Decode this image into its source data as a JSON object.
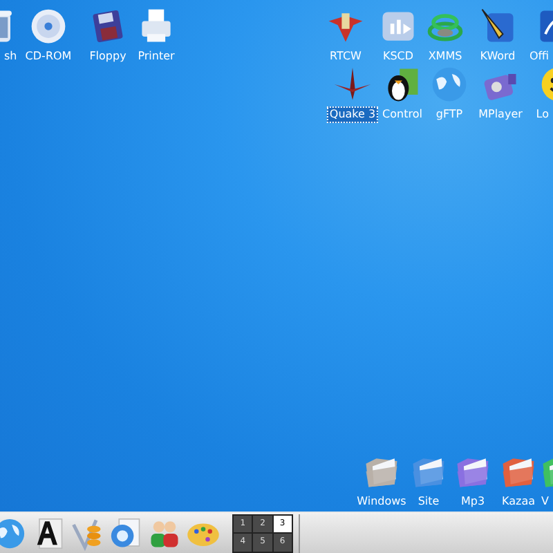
{
  "desktop_icons": [
    {
      "label": "sh",
      "kind": "trash",
      "selected": false
    },
    {
      "label": "CD-ROM",
      "kind": "cd",
      "selected": false
    },
    {
      "label": "Floppy",
      "kind": "floppy",
      "selected": false
    },
    {
      "label": "Printer",
      "kind": "printer",
      "selected": false
    },
    {
      "label": "RTCW",
      "kind": "emblem",
      "selected": false
    },
    {
      "label": "KSCD",
      "kind": "media",
      "selected": false
    },
    {
      "label": "XMMS",
      "kind": "rings",
      "selected": false
    },
    {
      "label": "KWord",
      "kind": "pen",
      "selected": false
    },
    {
      "label": "Offi",
      "kind": "document",
      "selected": false
    },
    {
      "label": "Quake 3",
      "kind": "jet",
      "selected": true
    },
    {
      "label": "Control",
      "kind": "penguin",
      "selected": false
    },
    {
      "label": "gFTP",
      "kind": "globe",
      "selected": false
    },
    {
      "label": "MPlayer",
      "kind": "camera",
      "selected": false
    },
    {
      "label": "Lo",
      "kind": "smiley",
      "selected": false
    },
    {
      "label": "Windows",
      "kind": "folder",
      "color": "#b8b0a8",
      "selected": false
    },
    {
      "label": "Site",
      "kind": "folder",
      "color": "#4a90e0",
      "selected": false
    },
    {
      "label": "Mp3",
      "kind": "folder",
      "color": "#8a70e0",
      "selected": false
    },
    {
      "label": "Kazaa",
      "kind": "folder",
      "color": "#e06040",
      "selected": false
    },
    {
      "label": "V",
      "kind": "folder",
      "color": "#40c060",
      "selected": false
    }
  ],
  "taskbar": {
    "launchers": [
      {
        "kind": "globe"
      },
      {
        "kind": "font"
      },
      {
        "kind": "coins"
      },
      {
        "kind": "web"
      },
      {
        "kind": "people"
      },
      {
        "kind": "palette"
      }
    ],
    "pager": [
      {
        "label": "1",
        "selected": false
      },
      {
        "label": "2",
        "selected": false
      },
      {
        "label": "3",
        "selected": true
      },
      {
        "label": "4",
        "selected": false
      },
      {
        "label": "5",
        "selected": false
      },
      {
        "label": "6",
        "selected": false
      }
    ]
  }
}
